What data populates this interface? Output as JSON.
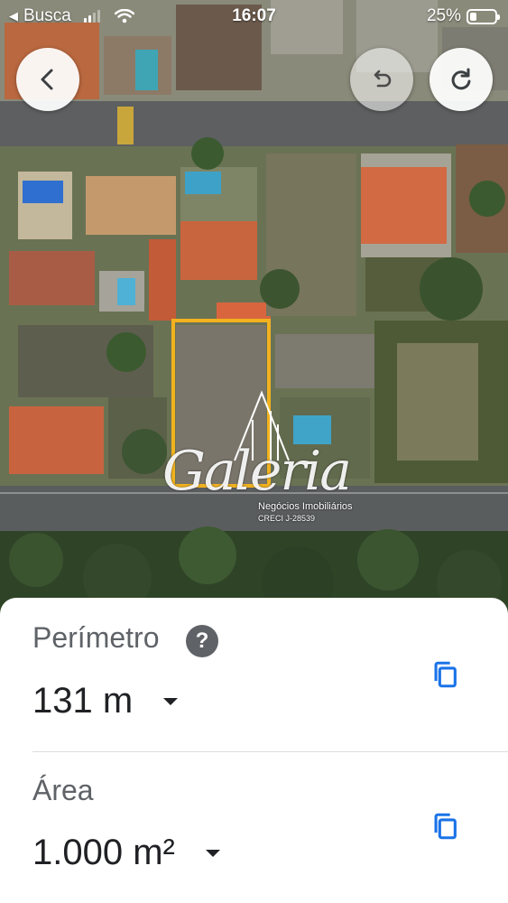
{
  "status_bar": {
    "back_app": "Busca",
    "time": "16:07",
    "battery": "25%",
    "battery_fraction": 0.25,
    "signal_bars": 2
  },
  "toolbar": {
    "back_icon": "chevron-left-icon",
    "undo_icon": "undo-icon",
    "redo_icon": "redo-icon"
  },
  "watermark": {
    "brand": "Galeria",
    "tagline": "Negócios Imobiliários",
    "creci": "CRECI J-28539"
  },
  "colors": {
    "selection_outline": "#f2b21f",
    "copy_icon": "#1a73e8",
    "label_gray": "#5f6368"
  },
  "measurements": {
    "perimeter": {
      "label": "Perímetro",
      "value": "131 m",
      "help_icon": "?"
    },
    "area": {
      "label": "Área",
      "value": "1.000 m²"
    }
  }
}
